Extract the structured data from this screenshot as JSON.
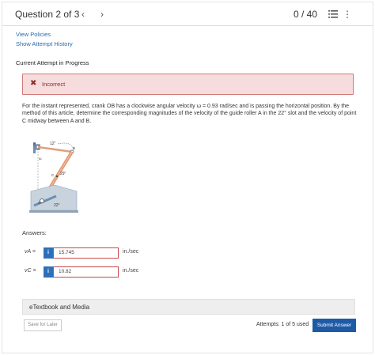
{
  "header": {
    "question_label": "Question 2 of 3",
    "prev_icon": "chevron-left-icon",
    "next_icon": "chevron-right-icon",
    "score": "0 / 40",
    "list_icon": "list-icon",
    "more_icon": "more-vertical-icon"
  },
  "links": {
    "view_policies": "View Policies",
    "show_history": "Show Attempt History"
  },
  "section": {
    "title": "Current Attempt in Progress"
  },
  "alert": {
    "icon": "x-icon",
    "text": "Incorrect"
  },
  "problem": {
    "text": "For the instant represented, crank OB has a clockwise angular velocity ω = 0.93 rad/sec and is passing the horizontal position. By the method of this article, determine the corresponding magnitudes of the velocity of the guide roller A in the 22° slot and the velocity of point C midway between A and B."
  },
  "figure": {
    "label_O": "O",
    "label_len": "12\"",
    "label_B": "B",
    "label_omega": "ω",
    "label_C": "C",
    "label_29": "29\"",
    "label_A": "A",
    "label_22": "22°"
  },
  "answers": {
    "label": "Answers:",
    "rows": [
      {
        "symbol": "vA =",
        "value": "15.745",
        "unit": "in./sec"
      },
      {
        "symbol": "vC =",
        "value": "10.82",
        "unit": "in./sec"
      }
    ]
  },
  "ebook": {
    "label": "eTextbook and Media"
  },
  "footer": {
    "save_label": "Save for Later",
    "attempts": "Attempts: 1 of 5 used",
    "submit_label": "Submit Answer"
  },
  "colors": {
    "accent": "#1f5aa6",
    "error_bg": "#f6dcdc",
    "error_border": "#d17a7a",
    "link": "#2a6ab0"
  }
}
